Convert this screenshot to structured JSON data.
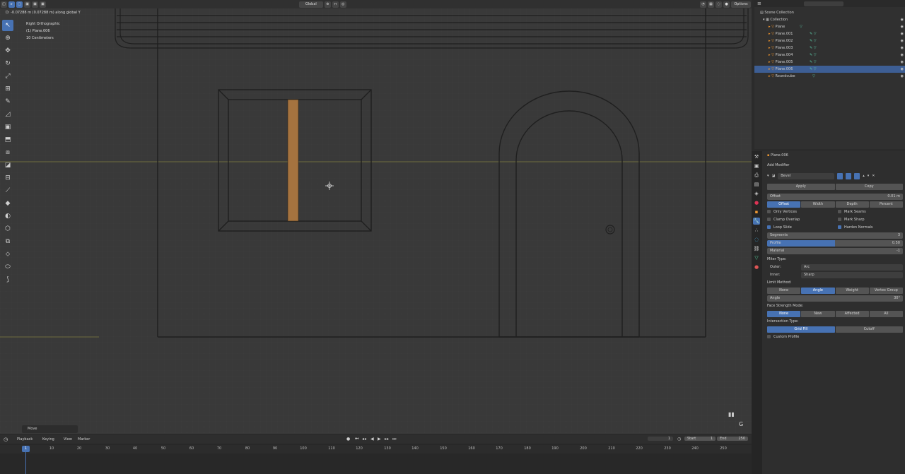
{
  "header": {
    "orientation": "Global",
    "options": "Options"
  },
  "viewport": {
    "status": "D: -0.07288 m (0.07288 m) along global Y",
    "view_name": "Right Orthographic",
    "object_label": "(1) Plane.006",
    "scale_label": "10 Centimeters",
    "move_panel": "Move",
    "gizmo_key": "G"
  },
  "outliner": {
    "items": [
      {
        "label": "Scene Collection"
      },
      {
        "label": "Collection"
      },
      {
        "label": "Plane"
      },
      {
        "label": "Plane.001"
      },
      {
        "label": "Plane.002"
      },
      {
        "label": "Plane.003"
      },
      {
        "label": "Plane.004"
      },
      {
        "label": "Plane.005"
      },
      {
        "label": "Plane.006"
      },
      {
        "label": "Roundcube"
      }
    ]
  },
  "properties": {
    "object_name": "Plane.006",
    "add_modifier": "Add Modifier",
    "modifier_name": "Bevel",
    "apply": "Apply",
    "copy": "Copy",
    "offset_label": "Offset",
    "offset_value": "0.01 m",
    "width_types": [
      "Offset",
      "Width",
      "Depth",
      "Percent"
    ],
    "checkboxes": {
      "only_vertices": "Only Vertices",
      "mark_seams": "Mark Seams",
      "clamp_overlap": "Clamp Overlap",
      "mark_sharp": "Mark Sharp",
      "loop_slide": "Loop Slide",
      "harden_normals": "Harden Normals"
    },
    "segments_label": "Segments",
    "segments_value": "3",
    "profile_label": "Profile",
    "profile_value": "0.50",
    "material_label": "Material",
    "material_value": "-1",
    "miter_type": "Miter Type:",
    "outer_label": "Outer:",
    "outer_value": "Arc",
    "inner_label": "Inner:",
    "inner_value": "Sharp",
    "limit_method": "Limit Method:",
    "limit_options": [
      "None",
      "Angle",
      "Weight",
      "Vertex Group"
    ],
    "angle_label": "Angle",
    "angle_value": "30°",
    "face_strength": "Face Strength Mode:",
    "face_options": [
      "None",
      "New",
      "Affected",
      "All"
    ],
    "intersection": "Intersection Type:",
    "intersection_options": [
      "Grid Fill",
      "Cutoff"
    ],
    "custom_profile": "Custom Profile"
  },
  "timeline": {
    "menu": [
      "Playback",
      "Keying",
      "View",
      "Marker"
    ],
    "current_frame": "1",
    "start_label": "Start",
    "start_value": "1",
    "end_label": "End",
    "end_value": "250",
    "playhead": "1",
    "ticks": [
      "10",
      "20",
      "30",
      "40",
      "50",
      "60",
      "70",
      "80",
      "90",
      "100",
      "110",
      "120",
      "130",
      "140",
      "150",
      "160",
      "170",
      "180",
      "190",
      "200",
      "210",
      "220",
      "230",
      "240",
      "250"
    ]
  }
}
